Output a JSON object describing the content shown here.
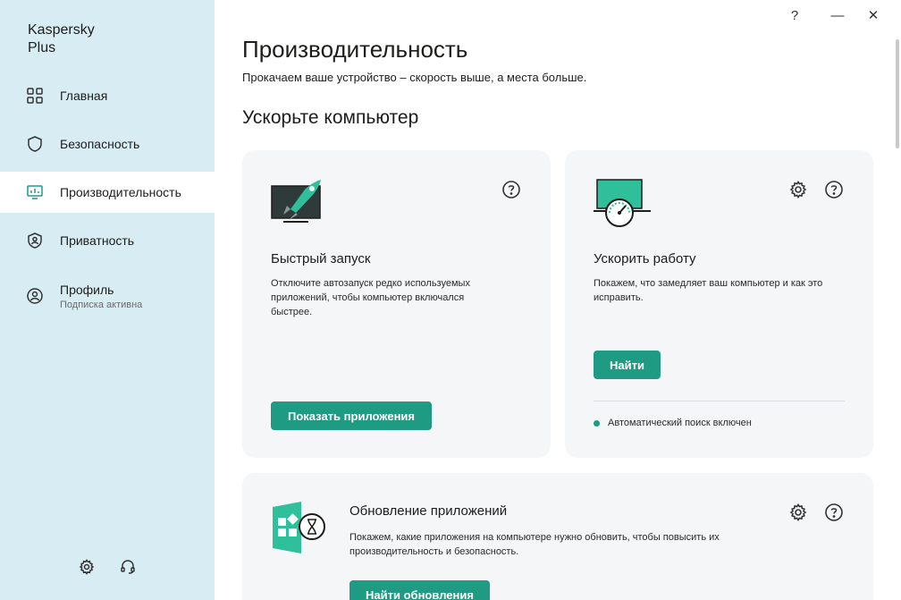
{
  "window": {
    "help": "?",
    "minimize": "—",
    "close": "✕"
  },
  "sidebar": {
    "brand": "Kaspersky\nPlus",
    "items": [
      {
        "label": "Главная",
        "icon": "grid-icon"
      },
      {
        "label": "Безопасность",
        "icon": "shield-icon"
      },
      {
        "label": "Производительность",
        "icon": "monitor-chart-icon"
      },
      {
        "label": "Приватность",
        "icon": "shield-person-icon"
      },
      {
        "label": "Профиль",
        "sub": "Подписка активна",
        "icon": "user-circle-icon"
      }
    ],
    "active": "Производительность",
    "footer": [
      "gear-icon",
      "headset-icon"
    ]
  },
  "main": {
    "title": "Производительность",
    "subtitle": "Прокачаем ваше устройство – скорость выше, а места больше.",
    "section_title": "Ускорьте компьютер",
    "cards": {
      "quick_start": {
        "title": "Быстрый запуск",
        "description": "Отключите автозапуск редко используемых приложений, чтобы компьютер включался быстрее.",
        "button": "Показать приложения"
      },
      "speed_up": {
        "title": "Ускорить работу",
        "description": "Покажем, что замедляет ваш компьютер и как это исправить.",
        "button": "Найти",
        "status": "Автоматический поиск включен"
      },
      "app_updates": {
        "title": "Обновление приложений",
        "description": "Покажем, какие приложения на компьютере нужно обновить, чтобы повысить их производительность и безопасность.",
        "button": "Найти обновления"
      }
    }
  },
  "colors": {
    "accent": "#1f9b84",
    "sidebar_bg": "#d8ecf3",
    "card_bg": "#f4f6f8"
  }
}
